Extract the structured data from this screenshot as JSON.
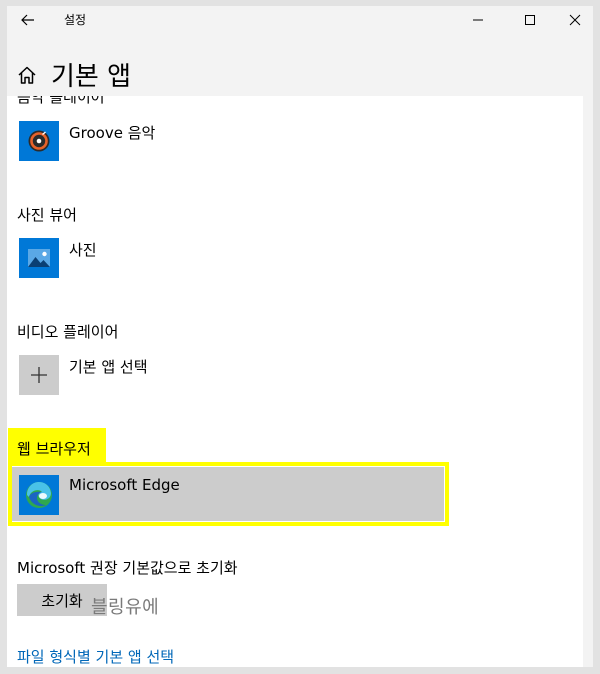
{
  "titlebar": {
    "title": "설정"
  },
  "header": {
    "title": "기본 앱"
  },
  "cut_off": {
    "label": "음악 플레이어"
  },
  "sections": [
    {
      "label": "",
      "app": "Groove 음악"
    },
    {
      "label": "사진 뷰어",
      "app": "사진"
    },
    {
      "label": "비디오 플레이어",
      "app": "기본 앱 선택"
    },
    {
      "label": "웹 브라우저",
      "app": "Microsoft Edge"
    }
  ],
  "reset": {
    "label": "Microsoft 권장 기본값으로 초기화",
    "button": "초기화"
  },
  "link": {
    "text": "파일 형식별 기본 앱 선택"
  },
  "watermark": {
    "text": "블링유에"
  },
  "colors": {
    "highlight": "#ffff00",
    "link": "#0067b8",
    "tile_blue": "#0078d7"
  }
}
